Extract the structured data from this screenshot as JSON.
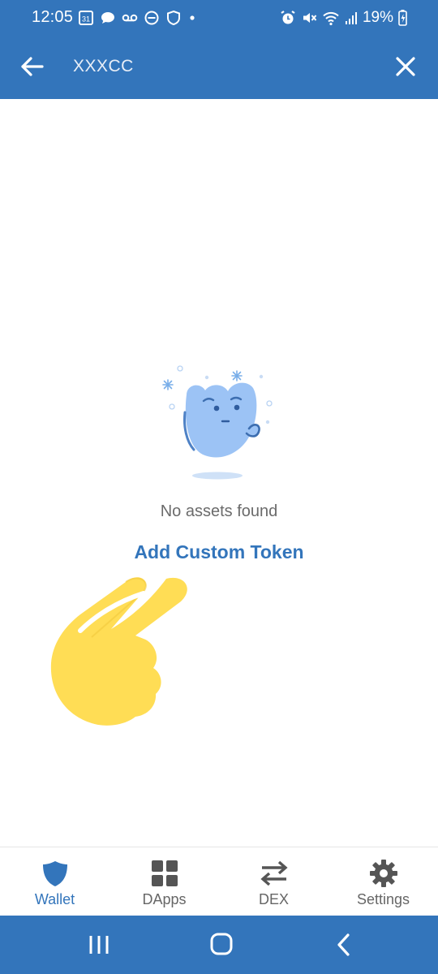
{
  "status_bar": {
    "time": "12:05",
    "calendar_day": "31",
    "battery_percent": "19%"
  },
  "search": {
    "value": "XXXCC"
  },
  "empty_state": {
    "message": "No assets found",
    "action_label": "Add Custom Token"
  },
  "bottom_nav": {
    "items": [
      {
        "label": "Wallet",
        "icon": "shield-icon",
        "active": true
      },
      {
        "label": "DApps",
        "icon": "grid-icon",
        "active": false
      },
      {
        "label": "DEX",
        "icon": "swap-arrows-icon",
        "active": false
      },
      {
        "label": "Settings",
        "icon": "gear-icon",
        "active": false
      }
    ]
  },
  "colors": {
    "primary": "#3375bb",
    "illustration": "#9cc3f5",
    "hand": "#ffdd55",
    "muted_text": "#6b6b6b"
  }
}
